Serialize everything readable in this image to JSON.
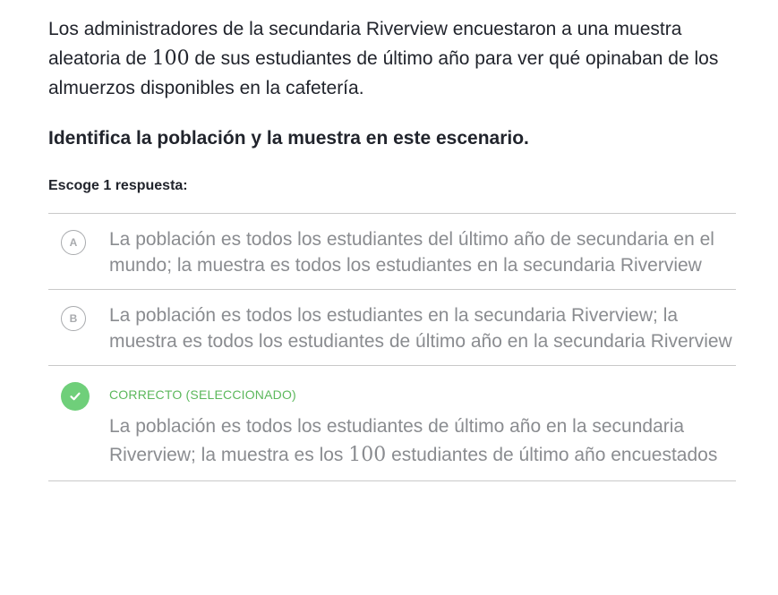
{
  "problem": {
    "text_part1": "Los administradores de la secundaria Riverview encuestaron a una muestra aleatoria de ",
    "sample_size": "100",
    "text_part2": " de sus estudiantes de último año para ver qué opinaban de los almuerzos disponibles en la cafetería."
  },
  "question": "Identifica la población y la muestra en este escenario.",
  "instruction": "Escoge 1 respuesta:",
  "choices": [
    {
      "letter": "A",
      "text": "La población es todos los estudiantes del último año de secundaria en el mundo; la muestra es todos los estudiantes en la secundaria Riverview"
    },
    {
      "letter": "B",
      "text": "La población es todos los estudiantes en la secundaria Riverview; la muestra es todos los estudiantes de último año en la secundaria Riverview"
    },
    {
      "status": "CORRECTO (SELECCIONADO)",
      "text_part1": "La población es todos los estudiantes de último año en la secundaria Riverview; la muestra es los ",
      "number": "100",
      "text_part2": " estudiantes de último año encuestados",
      "icon": "check-icon",
      "color": "#6fcf7a"
    }
  ]
}
